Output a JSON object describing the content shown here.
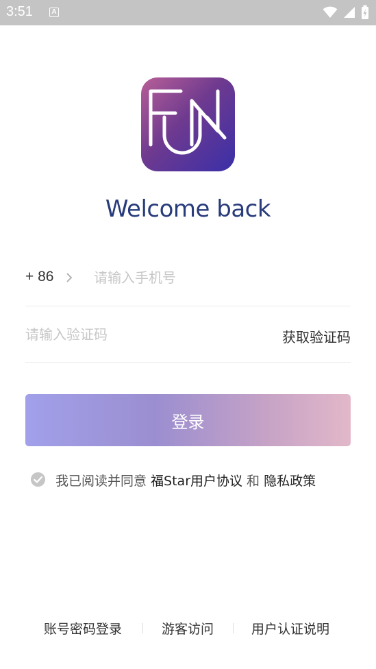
{
  "status_bar": {
    "time": "3:51",
    "notification_letter": "A"
  },
  "welcome": "Welcome back",
  "phone": {
    "country_code": "+ 86",
    "placeholder": "请输入手机号"
  },
  "code": {
    "placeholder": "请输入验证码",
    "get_code_label": "获取验证码"
  },
  "login_label": "登录",
  "agreement": {
    "prefix": "我已阅读并同意 ",
    "terms": "福Star用户协议",
    "and": " 和 ",
    "privacy": "隐私政策"
  },
  "bottom_links": {
    "password_login": "账号密码登录",
    "guest": "游客访问",
    "verify_info": "用户认证说明"
  },
  "colors": {
    "title": "#283b7a",
    "button_start": "#a1a0ea",
    "button_end": "#e2b8c9",
    "logo_start": "#b85f97",
    "logo_end": "#3a2fa8"
  }
}
